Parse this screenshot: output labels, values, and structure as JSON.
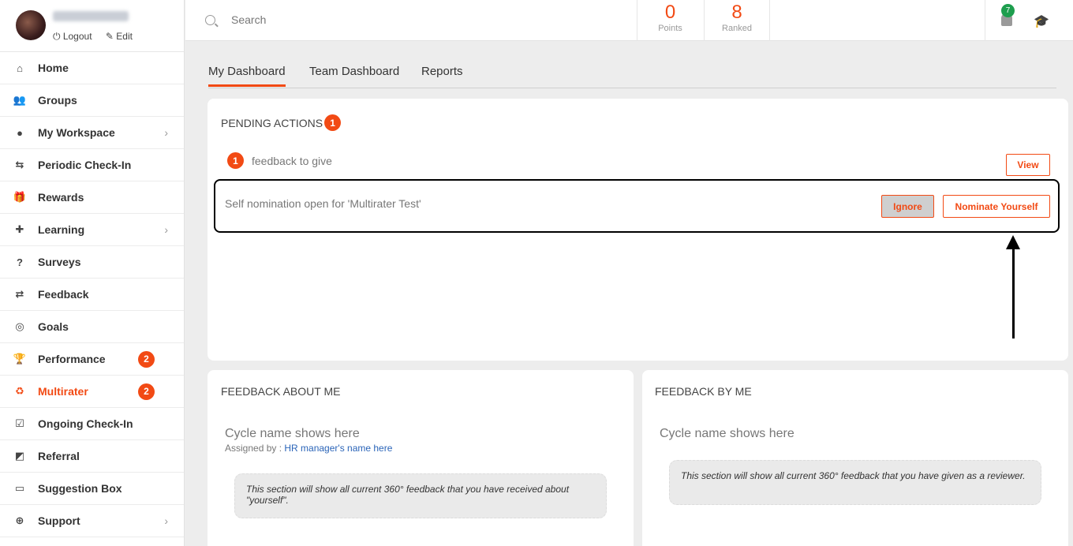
{
  "profile": {
    "logout_label": "⏻ Logout",
    "edit_label": "✎ Edit"
  },
  "sidebar": {
    "items": [
      {
        "label": "Home",
        "icon": "home-icon"
      },
      {
        "label": "Groups",
        "icon": "groups-icon"
      },
      {
        "label": "My Workspace",
        "icon": "user-icon",
        "chevron": "›"
      },
      {
        "label": "Periodic Check-In",
        "icon": "retweet-icon"
      },
      {
        "label": "Rewards",
        "icon": "gift-icon"
      },
      {
        "label": "Learning",
        "icon": "puzzle-icon",
        "chevron": "›"
      },
      {
        "label": "Surveys",
        "icon": "question-icon"
      },
      {
        "label": "Feedback",
        "icon": "exchange-icon"
      },
      {
        "label": "Goals",
        "icon": "target-icon"
      },
      {
        "label": "Performance",
        "icon": "trophy-icon",
        "badge": "2"
      },
      {
        "label": "Multirater",
        "icon": "recycle-icon",
        "badge": "2"
      },
      {
        "label": "Ongoing Check-In",
        "icon": "calendar-check-icon"
      },
      {
        "label": "Referral",
        "icon": "share-square-icon"
      },
      {
        "label": "Suggestion Box",
        "icon": "inbox-icon"
      },
      {
        "label": "Support",
        "icon": "lifebuoy-icon",
        "chevron": "›"
      }
    ],
    "active_index": 10,
    "accent": "#f24a14"
  },
  "topbar": {
    "search_placeholder": "Search",
    "points_value": "0",
    "points_label": "Points",
    "ranked_value": "8",
    "ranked_label": "Ranked",
    "notification_count": "7",
    "notification_color": "#1e9e4e"
  },
  "tabs": [
    "My Dashboard",
    "Team Dashboard",
    "Reports"
  ],
  "pending": {
    "title": "PENDING ACTIONS",
    "count": "1",
    "feedback_count": "1",
    "feedback_text": "feedback to give",
    "view_label": "View",
    "nomination_text": "Self nomination open for 'Multirater Test'",
    "ignore_label": "Ignore",
    "nominate_label": "Nominate Yourself"
  },
  "feedback_about_me": {
    "title": "FEEDBACK ABOUT ME",
    "cycle": "Cycle name shows here",
    "assigned_prefix": "Assigned by : ",
    "assigned_name": "HR manager's name here",
    "placeholder": "This section will show all current 360° feedback that you have received about \"yourself\"."
  },
  "feedback_by_me": {
    "title": "FEEDBACK BY ME",
    "cycle": "Cycle name shows here",
    "placeholder": "This section will show all current 360° feedback that you have given as a reviewer."
  }
}
